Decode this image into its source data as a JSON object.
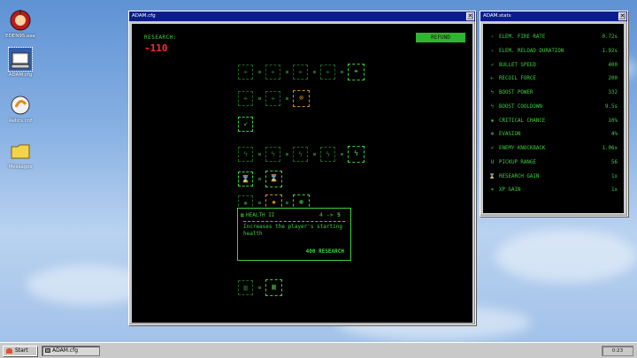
{
  "desktop": {
    "icons": [
      {
        "label": "EDEN95.exe"
      },
      {
        "label": "ADAM.cfg"
      },
      {
        "label": "Relics.cnf"
      },
      {
        "label": "Messages"
      }
    ]
  },
  "config_window": {
    "title": "ADAM.cfg",
    "research_label": "RESEARCH:",
    "research_value": "-110",
    "refund_label": "REFUND",
    "tooltip": {
      "name": "HEALTH II",
      "from_level": "4",
      "arrow": "->",
      "to_level": "5",
      "description": "Increases the player's starting health",
      "cost": "400 RESEARCH"
    }
  },
  "stats_window": {
    "title": "ADAM.stats",
    "rows": [
      {
        "icon": "fire-rate-icon",
        "glyph": "✧",
        "name": "ELEM. FIRE RATE",
        "value": "0.72s"
      },
      {
        "icon": "reload-icon",
        "glyph": "✧",
        "name": "ELEM. RELOAD DURATION",
        "value": "1.92s"
      },
      {
        "icon": "bullet-icon",
        "glyph": "➶",
        "name": "BULLET SPEED",
        "value": "400"
      },
      {
        "icon": "recoil-icon",
        "glyph": "⊢",
        "name": "RECOIL FORCE",
        "value": "200"
      },
      {
        "icon": "lightning-icon",
        "glyph": "ϟ",
        "name": "BOOST POWER",
        "value": "332"
      },
      {
        "icon": "lightning-icon",
        "glyph": "ϟ",
        "name": "BOOST COOLDOWN",
        "value": "9.5s"
      },
      {
        "icon": "critical-icon",
        "glyph": "✹",
        "name": "CRITICAL CHANCE",
        "value": "10%"
      },
      {
        "icon": "evasion-icon",
        "glyph": "⊛",
        "name": "EVASION",
        "value": "4%"
      },
      {
        "icon": "knockback-icon",
        "glyph": "➹",
        "name": "ENEMY KNOCKBACK",
        "value": "1.06x"
      },
      {
        "icon": "magnet-icon",
        "glyph": "U",
        "name": "PICKUP RANGE",
        "value": "56"
      },
      {
        "icon": "research-icon",
        "glyph": "⌛",
        "name": "RESEARCH GAIN",
        "value": "1x"
      },
      {
        "icon": "xp-icon",
        "glyph": "✶",
        "name": "XP GAIN",
        "value": "1x"
      }
    ]
  },
  "taskbar": {
    "start_label": "Start",
    "task_label": "ADAM.cfg",
    "clock": "0:23"
  },
  "colors": {
    "accent": "#3fd13f",
    "negative": "#ff2a2a",
    "available": "#e08a1e",
    "titlebar": "#0a1e8a"
  }
}
